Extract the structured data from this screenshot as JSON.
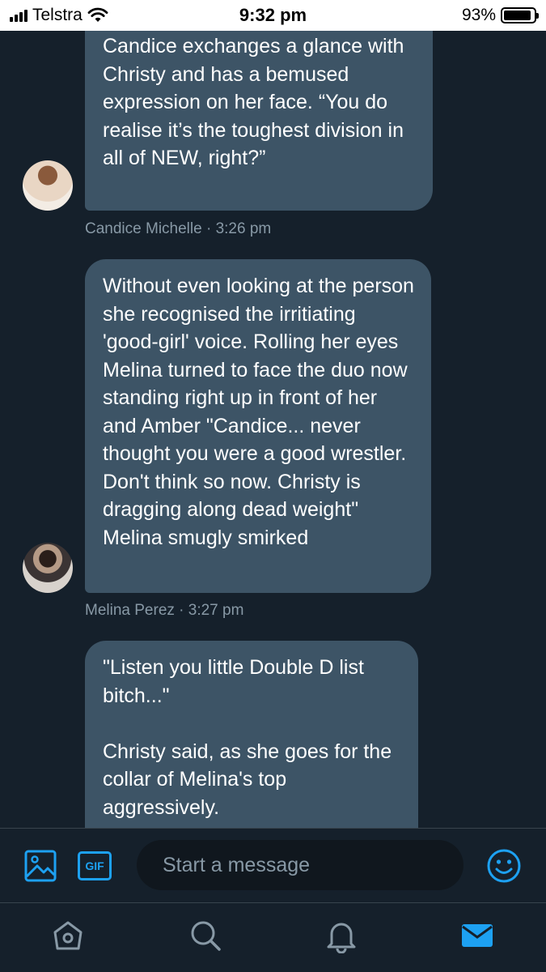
{
  "status_bar": {
    "carrier": "Telstra",
    "time": "9:32 pm",
    "battery_percent_text": "93%",
    "battery_level": 0.93
  },
  "messages": [
    {
      "text": "Candice exchanges a glance with Christy and has a bemused expression on  her face.   “You do realise it’s the toughest division in all of NEW, right?”",
      "sender": "Candice Michelle",
      "time": "3:26 pm",
      "meta": "Candice Michelle · 3:26 pm"
    },
    {
      "text": "Without even looking at the person she recognised the irritiating 'good-girl' voice. Rolling her eyes Melina turned to face the duo now standing right up in front of her and Amber \"Candice... never thought you were a good wrestler. Don't think so now. Christy is dragging along dead weight\" Melina smugly smirked",
      "sender": "Melina Perez",
      "time": "3:27 pm",
      "meta": "Melina Perez · 3:27 pm"
    },
    {
      "text": "\"Listen you little Double D list bitch...\"\n\nChristy said, as she goes for the collar of Melina's top aggressively."
    }
  ],
  "composer": {
    "placeholder": "Start a message",
    "value": "",
    "gif_label": "GIF"
  },
  "icons": {
    "image": "image-icon",
    "gif": "gif-icon",
    "emoji": "emoji-icon",
    "home": "home-icon",
    "search": "search-icon",
    "notifications": "bell-icon",
    "messages": "envelope-icon"
  },
  "colors": {
    "background": "#15202b",
    "bubble": "#3d5466",
    "accent": "#1da1f2",
    "meta_text": "#8899a6"
  }
}
